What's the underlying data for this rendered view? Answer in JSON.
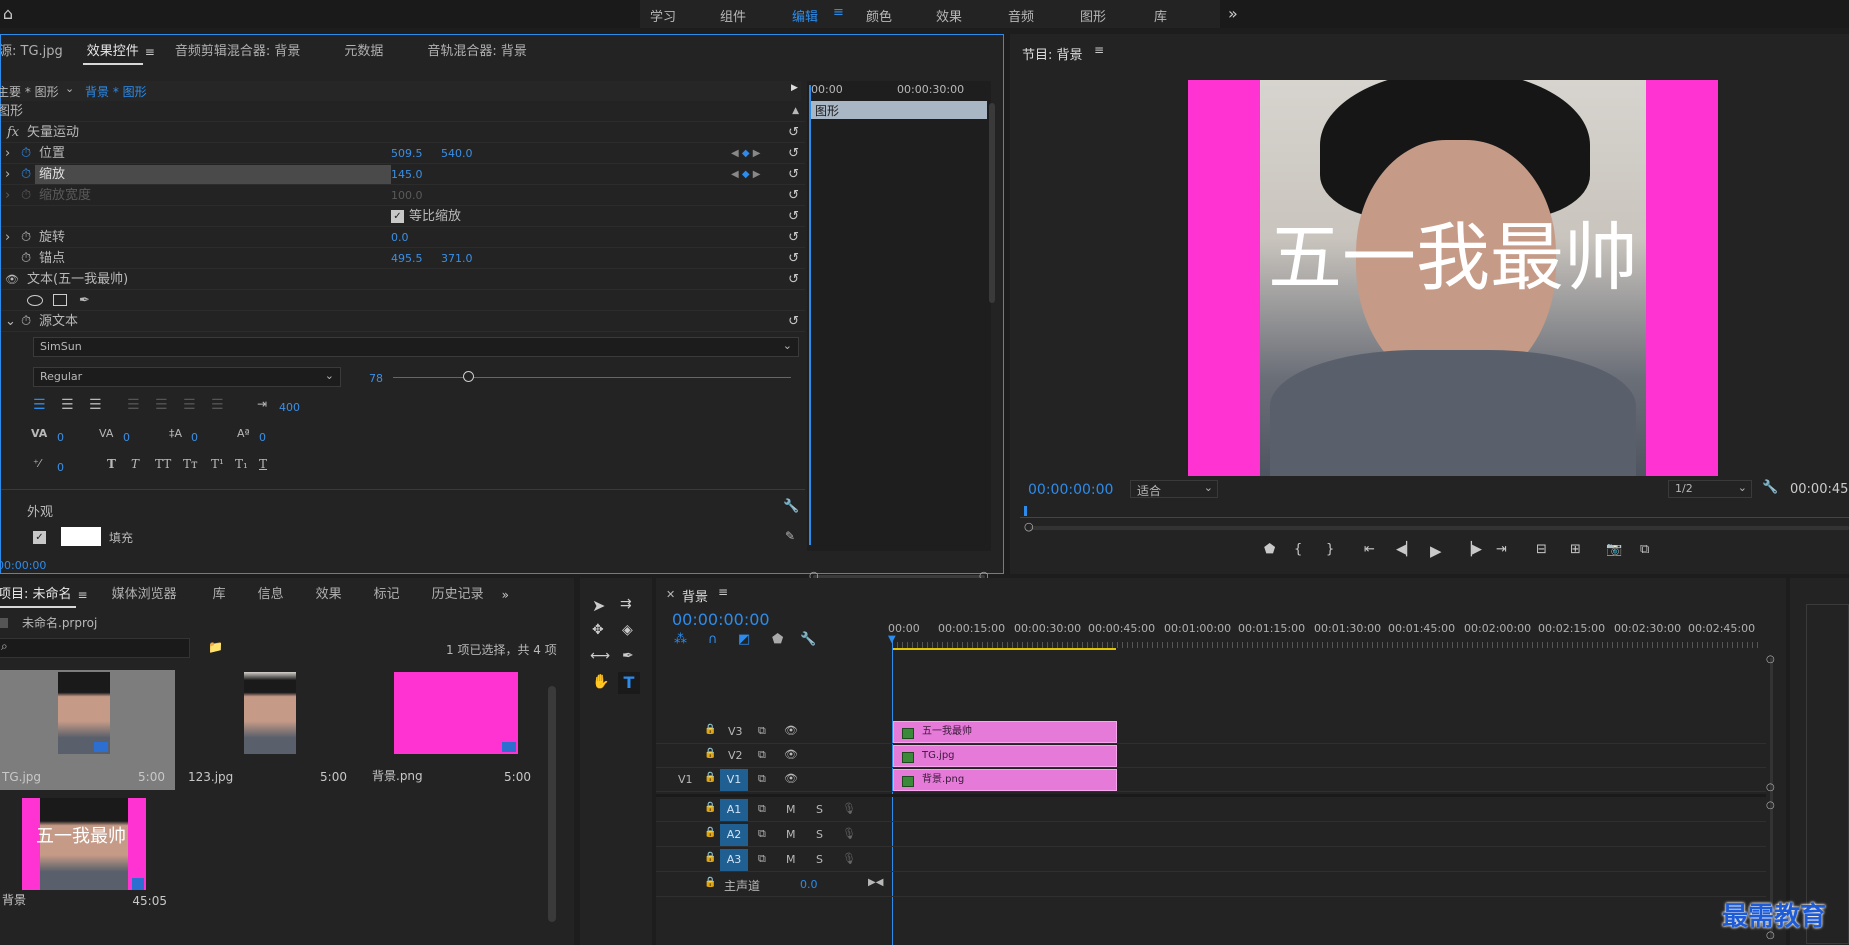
{
  "workspace": {
    "tabs": [
      "学习",
      "组件",
      "编辑",
      "颜色",
      "效果",
      "音频",
      "图形",
      "库"
    ],
    "active": "编辑",
    "more": "»"
  },
  "effects_panel": {
    "tabs": [
      "源: TG.jpg",
      "效果控件",
      "音频剪辑混合器: 背景",
      "元数据",
      "音轨混合器: 背景"
    ],
    "active_tab": "效果控件",
    "breadcrumb_master": "主要 * 图形",
    "breadcrumb_clip": "背景 * 图形",
    "section": "图形",
    "timecode_ruler": [
      "00:00",
      "00:00:30:00"
    ],
    "clip_label": "图形",
    "rows": {
      "vector_motion": "矢量运动",
      "position": {
        "label": "位置",
        "x": "509.5",
        "y": "540.0"
      },
      "scale": {
        "label": "缩放",
        "value": "145.0"
      },
      "scale_width": {
        "label": "缩放宽度",
        "value": "100.0"
      },
      "uniform_scale": "等比缩放",
      "rotation": {
        "label": "旋转",
        "value": "0.0"
      },
      "anchor": {
        "label": "锚点",
        "x": "495.5",
        "y": "371.0"
      },
      "text_layer": "文本(五一我最帅)",
      "source_text": "源文本"
    },
    "font_family": "SimSun",
    "font_style": "Regular",
    "font_size": "78",
    "tracking_value": "400",
    "kerning": "0",
    "tracking2": "0",
    "leading": "0",
    "baseline": "0",
    "tsume": "0",
    "text_style_buttons": [
      "T",
      "T",
      "TT",
      "Tт",
      "T¹",
      "T₁",
      "T"
    ],
    "appearance": "外观",
    "fill_label": "填充",
    "bottom_timecode": "00:00:00"
  },
  "program_monitor": {
    "title": "节目: 背景",
    "overlay_text": "五一我最帅",
    "timecode": "00:00:00:00",
    "fit": "适合",
    "resolution": "1/2",
    "duration": "00:00:45"
  },
  "project_panel": {
    "tabs": [
      "项目: 未命名",
      "媒体浏览器",
      "库",
      "信息",
      "效果",
      "标记",
      "历史记录"
    ],
    "active_tab": "项目: 未命名",
    "project_file": "未命名.prproj",
    "selection_info": "1 项已选择，共 4 项",
    "items": [
      {
        "name": "TG.jpg",
        "duration": "5:00"
      },
      {
        "name": "123.jpg",
        "duration": "5:00"
      },
      {
        "name": "背景.png",
        "duration": "5:00"
      },
      {
        "name": "背景",
        "duration": "45:05"
      }
    ],
    "thumb_text": "五一我最帅"
  },
  "timeline": {
    "title": "背景",
    "timecode": "00:00:00:00",
    "ruler": [
      "00:00",
      "00:00:15:00",
      "00:00:30:00",
      "00:00:45:00",
      "00:01:00:00",
      "00:01:15:00",
      "00:01:30:00",
      "00:01:45:00",
      "00:02:00:00",
      "00:02:15:00",
      "00:02:30:00",
      "00:02:45:00"
    ],
    "video_tracks": [
      "V3",
      "V2",
      "V1"
    ],
    "source_patch": "V1",
    "audio_tracks": [
      "A1",
      "A2",
      "A3"
    ],
    "mute": "M",
    "solo": "S",
    "master": "主声道",
    "master_value": "0.0",
    "clips": {
      "v3": "五一我最帅",
      "v2": "TG.jpg",
      "v1": "背景.png"
    }
  },
  "watermark": "最需教育",
  "colors": {
    "accent": "#2d8ceb",
    "clip": "#e57ad9",
    "magenta": "#ff32d2"
  }
}
